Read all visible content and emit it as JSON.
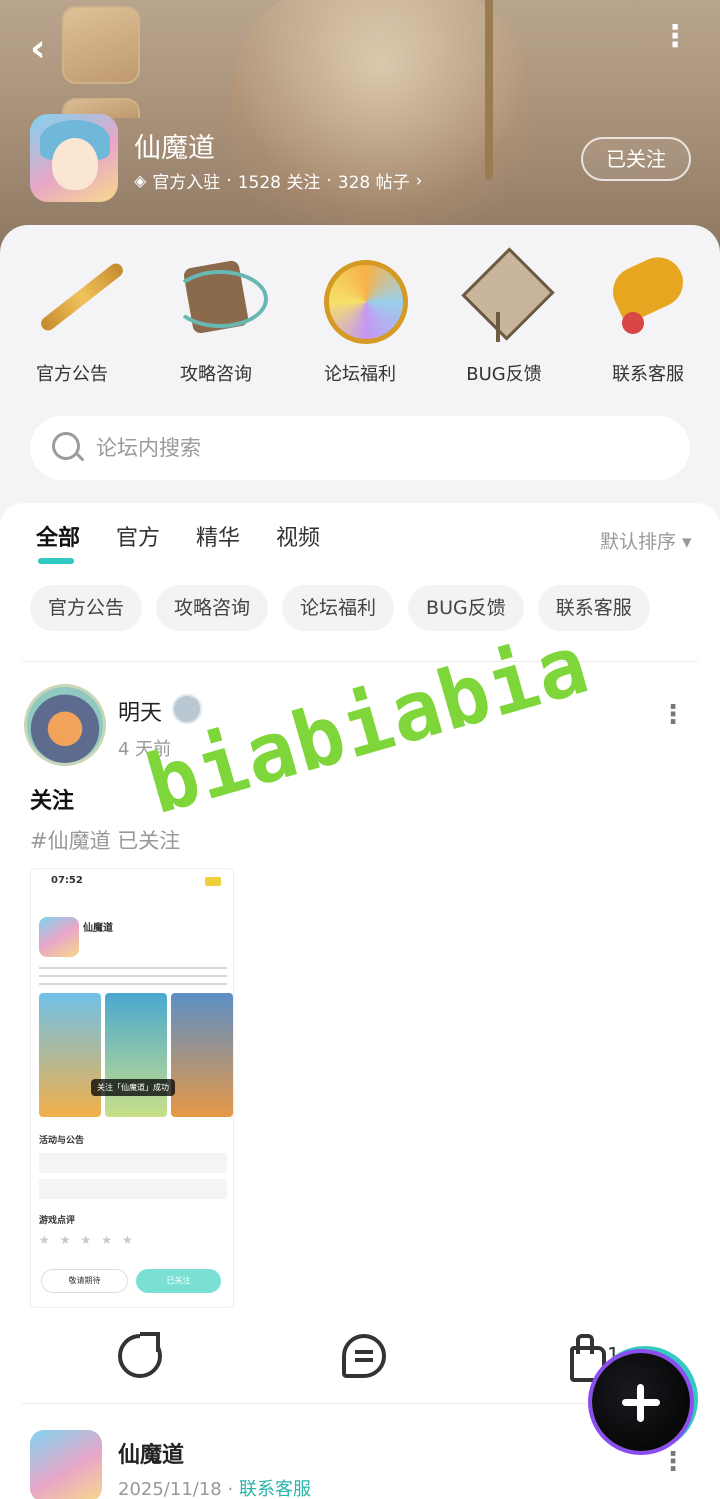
{
  "header": {
    "forum_name": "仙魔道",
    "badge_text": "官方入驻",
    "follow_count": "1528 关注",
    "post_count": "328 帖子",
    "meta_sep": "·",
    "meta_chevron": "›",
    "follow_button": "已关注",
    "back_glyph": "‹",
    "more_glyph": "⋮"
  },
  "quick_menu": {
    "items": [
      {
        "label": "官方公告",
        "icon": "flute-announcement-icon"
      },
      {
        "label": "攻略咨询",
        "icon": "scroll-guide-icon"
      },
      {
        "label": "论坛福利",
        "icon": "gem-welfare-icon"
      },
      {
        "label": "BUG反馈",
        "icon": "kite-bug-icon"
      },
      {
        "label": "联系客服",
        "icon": "ruyi-service-icon"
      }
    ]
  },
  "search": {
    "placeholder": "论坛内搜索"
  },
  "tabs": {
    "items": [
      "全部",
      "官方",
      "精华",
      "视频"
    ],
    "active": "全部",
    "sort_label": "默认排序 ▾"
  },
  "chips": [
    "官方公告",
    "攻略咨询",
    "论坛福利",
    "BUG反馈",
    "联系客服"
  ],
  "post": {
    "username": "明天",
    "time": "4 天前",
    "title": "关注",
    "tag_text": "#仙魔道 已关注",
    "watermark": "biabiabia",
    "image": {
      "status_time": "07:52",
      "app_name": "仙魔道",
      "toast": "关注「仙魔道」成功",
      "section1": "活动与公告",
      "section2": "游戏点评",
      "stars": "★★★★★",
      "btn1": "敬请期待",
      "btn2": "已关注"
    },
    "like_count": "1"
  },
  "post2": {
    "name": "仙魔道",
    "date": "2025/11/18",
    "sep": "·",
    "link": "联系客服"
  },
  "colors": {
    "accent": "#2fc9c1",
    "watermark": "#7ed63a",
    "fab_ring": "#8d4df0"
  }
}
